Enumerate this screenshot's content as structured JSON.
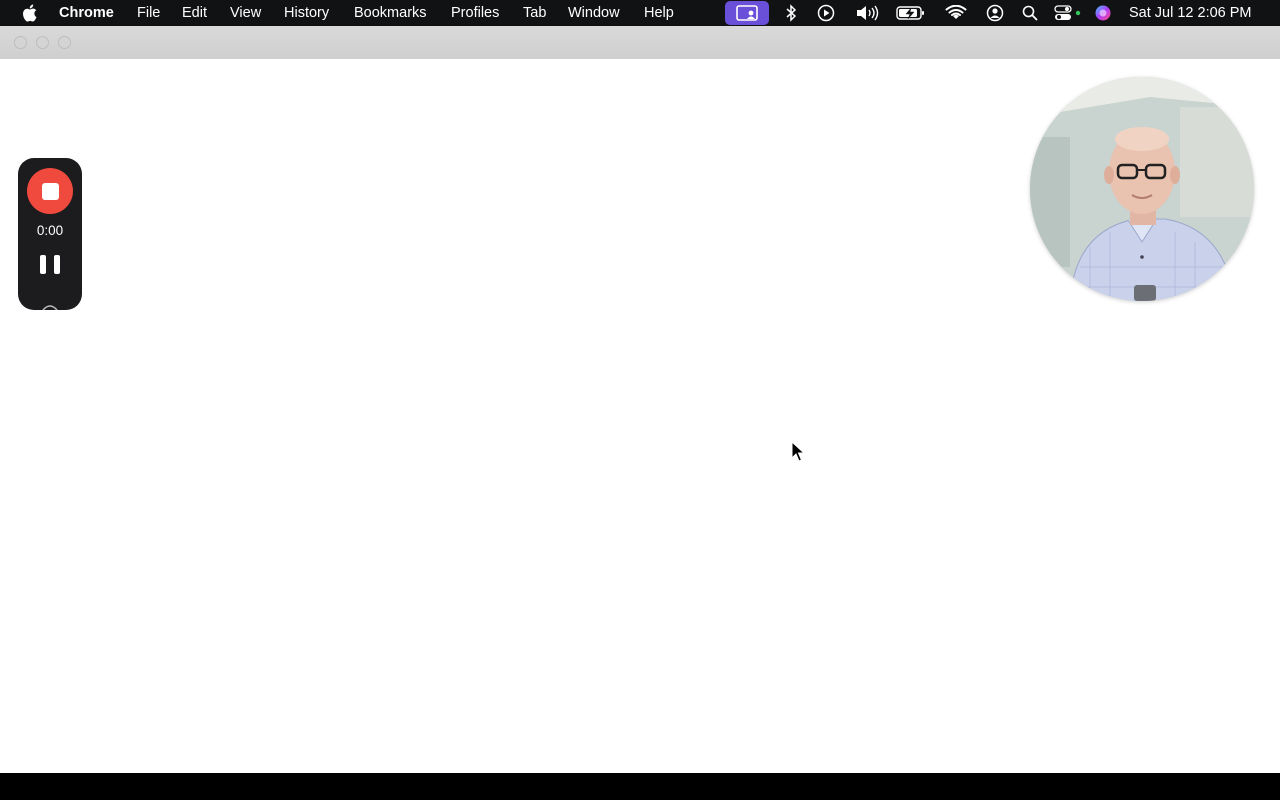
{
  "menubar": {
    "app_name": "Chrome",
    "items": [
      "File",
      "Edit",
      "View",
      "History",
      "Bookmarks",
      "Profiles",
      "Tab",
      "Window",
      "Help"
    ],
    "clock": "Sat Jul 12  2:06 PM",
    "status_icons": [
      "screen-recording-icon",
      "bluetooth-icon",
      "play-icon",
      "volume-icon",
      "battery-charging-icon",
      "wifi-icon",
      "user-account-icon",
      "spotlight-search-icon",
      "control-center-icon",
      "siri-icon"
    ],
    "accent_color": "#6a4fd8"
  },
  "recorder": {
    "timer": "0:00",
    "stop_color": "#f04a3e"
  },
  "webcam": {
    "description_icon": "webcam-bubble"
  }
}
